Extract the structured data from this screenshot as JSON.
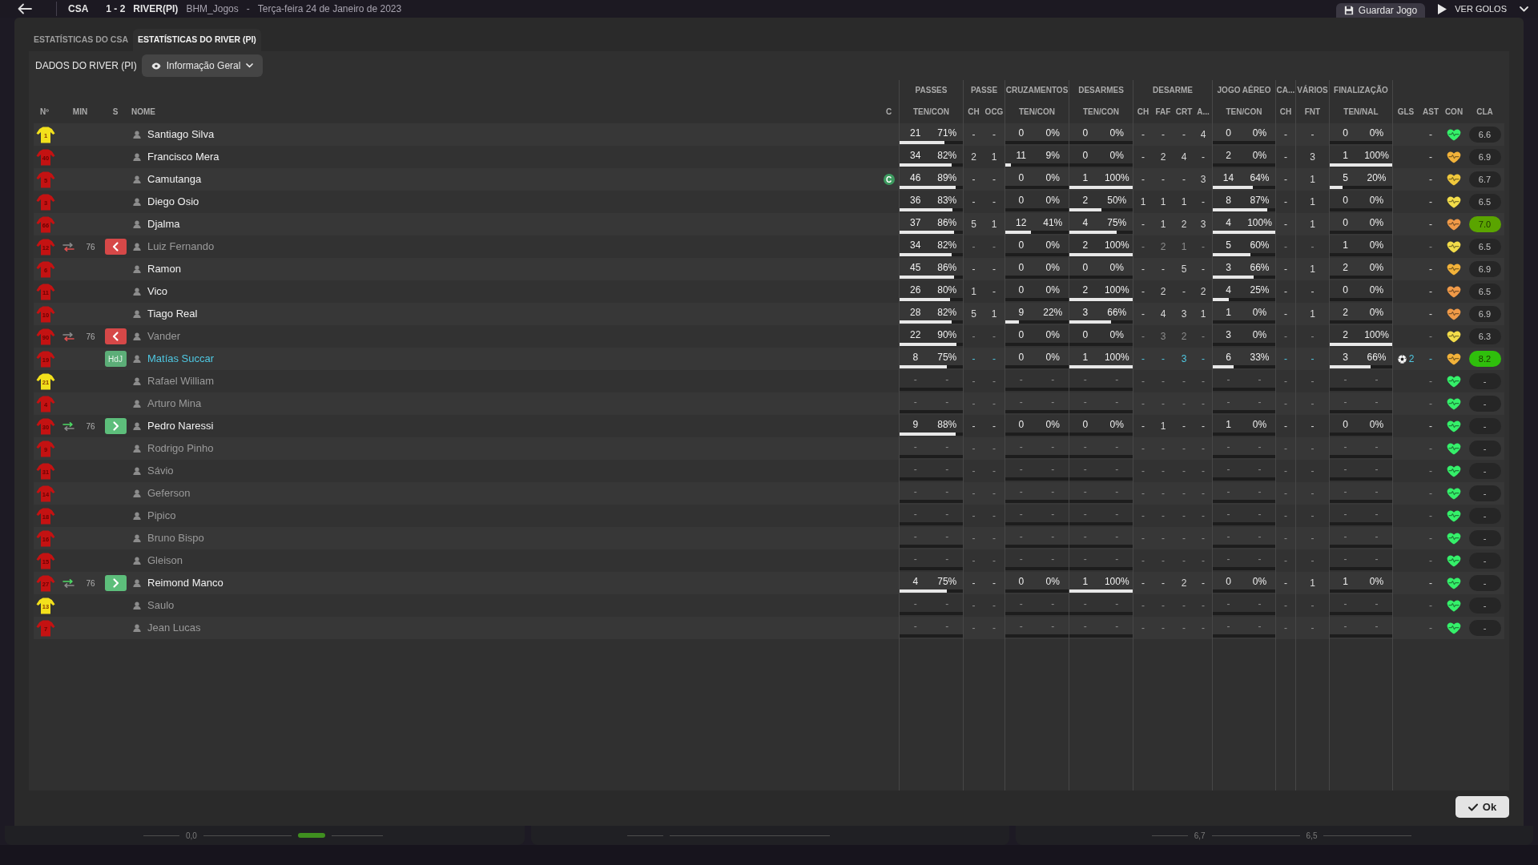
{
  "top_bar": {
    "home_team": "CSA",
    "score": "1 - 2",
    "away_team": "RIVER(PI)",
    "save_name": "BHM_Jogos",
    "separator": "-",
    "date": "Terça-feira 24 de Janeiro de 2023",
    "buttons": [
      {
        "kind": "save",
        "label": "Guardar Jogo"
      },
      {
        "kind": "goals",
        "label": "VER GOLOS"
      }
    ]
  },
  "tabs": [
    {
      "label": "ESTATÍSTICAS DO CSA",
      "selected": false
    },
    {
      "label": "ESTATÍSTICAS DO RIVER (PI)",
      "selected": true
    }
  ],
  "section_title": "DADOS DO RIVER (PI)",
  "view_selector": {
    "label": "Informação Geral"
  },
  "table": {
    "lead_columns": [
      "Nº",
      "MIN",
      "S",
      "NOME",
      "C"
    ],
    "groups": [
      {
        "title": "PASSES",
        "columns": [
          {
            "label": "TEN/CON",
            "kind": "pair"
          }
        ]
      },
      {
        "title": "PASSE",
        "columns": [
          {
            "label": "CH",
            "kind": "single"
          },
          {
            "label": "OCG",
            "kind": "single"
          }
        ]
      },
      {
        "title": "CRUZAMENTOS",
        "columns": [
          {
            "label": "TEN/CON",
            "kind": "pair"
          }
        ]
      },
      {
        "title": "DESARMES",
        "columns": [
          {
            "label": "TEN/CON",
            "kind": "pair"
          }
        ]
      },
      {
        "title": "DESARME",
        "columns": [
          {
            "label": "CH",
            "kind": "single"
          },
          {
            "label": "FAF",
            "kind": "single"
          },
          {
            "label": "CRT",
            "kind": "single"
          },
          {
            "label": "A...",
            "kind": "single"
          }
        ]
      },
      {
        "title": "JOGO AÉREO",
        "columns": [
          {
            "label": "TEN/CON",
            "kind": "pair"
          }
        ]
      },
      {
        "title": "CA...",
        "columns": [
          {
            "label": "CH",
            "kind": "single"
          }
        ]
      },
      {
        "title": "VÁRIOS",
        "columns": [
          {
            "label": "FNT",
            "kind": "single"
          }
        ]
      },
      {
        "title": "FINALIZAÇÃO",
        "columns": [
          {
            "label": "TEN/NAL",
            "kind": "pair"
          }
        ]
      }
    ],
    "tail_columns": [
      "GLS",
      "AST",
      "CON",
      "CLA"
    ],
    "rows": [
      {
        "shirt": {
          "number": "1",
          "color": "#f2e01c"
        },
        "name": "Santiago Silva",
        "kind": "played",
        "stats": [
          {
            "count": "21",
            "rate": "71%",
            "level": 0.71
          },
          "-",
          "-",
          {
            "count": "0",
            "rate": "0%",
            "level": 0
          },
          {
            "count": "0",
            "rate": "0%",
            "level": 0
          },
          "-",
          "-",
          "-",
          "4",
          {
            "count": "0",
            "rate": "0%",
            "level": 0
          },
          "-",
          "-",
          {
            "count": "0",
            "rate": "0%",
            "level": 0
          }
        ],
        "assists": "-",
        "morale": {
          "color": "#35f06a"
        },
        "rating": {
          "value": "6.6",
          "color": "#262626"
        }
      },
      {
        "shirt": {
          "number": "40",
          "color": "#c41212"
        },
        "name": "Francisco Mera",
        "kind": "played",
        "stats": [
          {
            "count": "34",
            "rate": "82%",
            "level": 0.82
          },
          "2",
          "1",
          {
            "count": "11",
            "rate": "9%",
            "level": 0.09
          },
          {
            "count": "0",
            "rate": "0%",
            "level": 0
          },
          "-",
          "2",
          "4",
          "-",
          {
            "count": "2",
            "rate": "0%",
            "level": 0
          },
          "-",
          "3",
          {
            "count": "1",
            "rate": "100%",
            "level": 1
          }
        ],
        "assists": "-",
        "morale": {
          "color": "#f2b23a"
        },
        "rating": {
          "value": "6.9",
          "color": "#262626"
        }
      },
      {
        "shirt": {
          "number": "5",
          "color": "#c41212"
        },
        "name": "Camutanga",
        "kind": "played",
        "captain": "C",
        "stats": [
          {
            "count": "46",
            "rate": "89%",
            "level": 0.89
          },
          "-",
          "-",
          {
            "count": "0",
            "rate": "0%",
            "level": 0
          },
          {
            "count": "1",
            "rate": "100%",
            "level": 1
          },
          "-",
          "-",
          "-",
          "3",
          {
            "count": "14",
            "rate": "64%",
            "level": 0.64
          },
          "-",
          "1",
          {
            "count": "5",
            "rate": "20%",
            "level": 0.2
          }
        ],
        "assists": "-",
        "morale": {
          "color": "#f0c83c"
        },
        "rating": {
          "value": "6.7",
          "color": "#262626"
        }
      },
      {
        "shirt": {
          "number": "3",
          "color": "#c41212"
        },
        "name": "Diego Osio",
        "kind": "played",
        "stats": [
          {
            "count": "36",
            "rate": "83%",
            "level": 0.83
          },
          "-",
          "-",
          {
            "count": "0",
            "rate": "0%",
            "level": 0
          },
          {
            "count": "2",
            "rate": "50%",
            "level": 0.5
          },
          "1",
          "1",
          "1",
          "-",
          {
            "count": "8",
            "rate": "87%",
            "level": 0.87
          },
          "-",
          "1",
          {
            "count": "0",
            "rate": "0%",
            "level": 0
          }
        ],
        "assists": "-",
        "morale": {
          "color": "#f2dc4a"
        },
        "rating": {
          "value": "6.5",
          "color": "#262626"
        }
      },
      {
        "shirt": {
          "number": "66",
          "color": "#c41212"
        },
        "name": "Djalma",
        "kind": "played",
        "stats": [
          {
            "count": "37",
            "rate": "86%",
            "level": 0.86
          },
          "5",
          "1",
          {
            "count": "12",
            "rate": "41%",
            "level": 0.41
          },
          {
            "count": "4",
            "rate": "75%",
            "level": 0.75
          },
          "-",
          "1",
          "2",
          "3",
          {
            "count": "4",
            "rate": "100%",
            "level": 1
          },
          "-",
          "1",
          {
            "count": "0",
            "rate": "0%",
            "level": 0
          }
        ],
        "assists": "-",
        "morale": {
          "color": "#f09a48"
        },
        "rating": {
          "value": "7.0",
          "color": "#5aa400"
        }
      },
      {
        "shirt": {
          "number": "12",
          "color": "#c41212"
        },
        "sub": {
          "kind": "off",
          "minute": "76"
        },
        "badge": {
          "kind": "off"
        },
        "name": "Luiz Fernando",
        "kind": "off",
        "stats": [
          {
            "count": "34",
            "rate": "82%",
            "level": 0.82
          },
          "-",
          "-",
          {
            "count": "0",
            "rate": "0%",
            "level": 0
          },
          {
            "count": "2",
            "rate": "100%",
            "level": 1
          },
          "-",
          "2",
          "1",
          "-",
          {
            "count": "5",
            "rate": "60%",
            "level": 0.6
          },
          "-",
          "-",
          {
            "count": "1",
            "rate": "0%",
            "level": 0
          }
        ],
        "assists": "-",
        "morale": {
          "color": "#f2dc4a"
        },
        "rating": {
          "value": "6.5",
          "color": "#262626"
        }
      },
      {
        "shirt": {
          "number": "6",
          "color": "#c41212"
        },
        "name": "Ramon",
        "kind": "played",
        "stats": [
          {
            "count": "45",
            "rate": "86%",
            "level": 0.86
          },
          "-",
          "-",
          {
            "count": "0",
            "rate": "0%",
            "level": 0
          },
          {
            "count": "0",
            "rate": "0%",
            "level": 0
          },
          "-",
          "-",
          "5",
          "-",
          {
            "count": "3",
            "rate": "66%",
            "level": 0.66
          },
          "-",
          "1",
          {
            "count": "2",
            "rate": "0%",
            "level": 0
          }
        ],
        "assists": "-",
        "morale": {
          "color": "#f2b23a"
        },
        "rating": {
          "value": "6.9",
          "color": "#262626"
        }
      },
      {
        "shirt": {
          "number": "11",
          "color": "#c41212"
        },
        "name": "Vico",
        "kind": "played",
        "stats": [
          {
            "count": "26",
            "rate": "80%",
            "level": 0.8
          },
          "1",
          "-",
          {
            "count": "0",
            "rate": "0%",
            "level": 0
          },
          {
            "count": "2",
            "rate": "100%",
            "level": 1
          },
          "-",
          "2",
          "-",
          "2",
          {
            "count": "4",
            "rate": "25%",
            "level": 0.25
          },
          "-",
          "-",
          {
            "count": "0",
            "rate": "0%",
            "level": 0
          }
        ],
        "assists": "-",
        "morale": {
          "color": "#f09a48"
        },
        "rating": {
          "value": "6.5",
          "color": "#262626"
        }
      },
      {
        "shirt": {
          "number": "10",
          "color": "#c41212"
        },
        "name": "Tiago Real",
        "kind": "played",
        "stats": [
          {
            "count": "28",
            "rate": "82%",
            "level": 0.82
          },
          "5",
          "1",
          {
            "count": "9",
            "rate": "22%",
            "level": 0.22
          },
          {
            "count": "3",
            "rate": "66%",
            "level": 0.66
          },
          "-",
          "4",
          "3",
          "1",
          {
            "count": "1",
            "rate": "0%",
            "level": 0
          },
          "-",
          "1",
          {
            "count": "2",
            "rate": "0%",
            "level": 0
          }
        ],
        "assists": "-",
        "morale": {
          "color": "#f09a48"
        },
        "rating": {
          "value": "6.9",
          "color": "#262626"
        }
      },
      {
        "shirt": {
          "number": "90",
          "color": "#c41212"
        },
        "sub": {
          "kind": "off",
          "minute": "76"
        },
        "badge": {
          "kind": "off"
        },
        "name": "Vander",
        "kind": "off",
        "stats": [
          {
            "count": "22",
            "rate": "90%",
            "level": 0.9
          },
          "-",
          "-",
          {
            "count": "0",
            "rate": "0%",
            "level": 0
          },
          {
            "count": "0",
            "rate": "0%",
            "level": 0
          },
          "-",
          "3",
          "2",
          "-",
          {
            "count": "3",
            "rate": "0%",
            "level": 0
          },
          "-",
          "-",
          {
            "count": "2",
            "rate": "100%",
            "level": 1
          }
        ],
        "assists": "-",
        "morale": {
          "color": "#f2dc4a"
        },
        "rating": {
          "value": "6.3",
          "color": "#262626"
        }
      },
      {
        "shirt": {
          "number": "19",
          "color": "#c41212"
        },
        "badge": {
          "kind": "potm",
          "label": "HdJ"
        },
        "name": "Matías Succar",
        "kind": "star",
        "stats": [
          {
            "count": "8",
            "rate": "75%",
            "level": 0.75
          },
          "-",
          "-",
          {
            "count": "0",
            "rate": "0%",
            "level": 0
          },
          {
            "count": "1",
            "rate": "100%",
            "level": 1
          },
          "-",
          "-",
          "3",
          "-",
          {
            "count": "6",
            "rate": "33%",
            "level": 0.33
          },
          "-",
          "-",
          {
            "count": "3",
            "rate": "66%",
            "level": 0.66
          }
        ],
        "goals": "2",
        "assists": "-",
        "morale": {
          "color": "#f2b23a"
        },
        "rating": {
          "value": "8.2",
          "color": "#2fbf0c"
        }
      },
      {
        "shirt": {
          "number": "21",
          "color": "#f2e01c"
        },
        "name": "Rafael William",
        "kind": "unused",
        "stats": [
          {
            "count": "-",
            "rate": "-",
            "level": 0
          },
          "-",
          "-",
          {
            "count": "-",
            "rate": "-",
            "level": 0
          },
          {
            "count": "-",
            "rate": "-",
            "level": 0
          },
          "-",
          "-",
          "-",
          "-",
          {
            "count": "-",
            "rate": "-",
            "level": 0
          },
          "-",
          "-",
          {
            "count": "-",
            "rate": "-",
            "level": 0
          }
        ],
        "assists": "-",
        "morale": {
          "color": "#35f06a"
        },
        "rating": {
          "value": "-",
          "color": "#262626"
        }
      },
      {
        "shirt": {
          "number": "4",
          "color": "#c41212"
        },
        "name": "Arturo Mina",
        "kind": "unused",
        "stats": [
          {
            "count": "-",
            "rate": "-",
            "level": 0
          },
          "-",
          "-",
          {
            "count": "-",
            "rate": "-",
            "level": 0
          },
          {
            "count": "-",
            "rate": "-",
            "level": 0
          },
          "-",
          "-",
          "-",
          "-",
          {
            "count": "-",
            "rate": "-",
            "level": 0
          },
          "-",
          "-",
          {
            "count": "-",
            "rate": "-",
            "level": 0
          }
        ],
        "assists": "-",
        "morale": {
          "color": "#35f06a"
        },
        "rating": {
          "value": "-",
          "color": "#262626"
        }
      },
      {
        "shirt": {
          "number": "30",
          "color": "#c41212"
        },
        "sub": {
          "kind": "on",
          "minute": "76"
        },
        "badge": {
          "kind": "on"
        },
        "name": "Pedro Naressi",
        "kind": "played",
        "stats": [
          {
            "count": "9",
            "rate": "88%",
            "level": 0.88
          },
          "-",
          "-",
          {
            "count": "0",
            "rate": "0%",
            "level": 0
          },
          {
            "count": "0",
            "rate": "0%",
            "level": 0
          },
          "-",
          "1",
          "-",
          "-",
          {
            "count": "1",
            "rate": "0%",
            "level": 0
          },
          "-",
          "-",
          {
            "count": "0",
            "rate": "0%",
            "level": 0
          }
        ],
        "assists": "-",
        "morale": {
          "color": "#35f06a"
        },
        "rating": {
          "value": "-",
          "color": "#262626"
        }
      },
      {
        "shirt": {
          "number": "9",
          "color": "#c41212"
        },
        "name": "Rodrigo Pinho",
        "kind": "unused",
        "stats": [
          {
            "count": "-",
            "rate": "-",
            "level": 0
          },
          "-",
          "-",
          {
            "count": "-",
            "rate": "-",
            "level": 0
          },
          {
            "count": "-",
            "rate": "-",
            "level": 0
          },
          "-",
          "-",
          "-",
          "-",
          {
            "count": "-",
            "rate": "-",
            "level": 0
          },
          "-",
          "-",
          {
            "count": "-",
            "rate": "-",
            "level": 0
          }
        ],
        "assists": "-",
        "morale": {
          "color": "#35f06a"
        },
        "rating": {
          "value": "-",
          "color": "#262626"
        }
      },
      {
        "shirt": {
          "number": "31",
          "color": "#c41212"
        },
        "name": "Sávio",
        "kind": "unused",
        "stats": [
          {
            "count": "-",
            "rate": "-",
            "level": 0
          },
          "-",
          "-",
          {
            "count": "-",
            "rate": "-",
            "level": 0
          },
          {
            "count": "-",
            "rate": "-",
            "level": 0
          },
          "-",
          "-",
          "-",
          "-",
          {
            "count": "-",
            "rate": "-",
            "level": 0
          },
          "-",
          "-",
          {
            "count": "-",
            "rate": "-",
            "level": 0
          }
        ],
        "assists": "-",
        "morale": {
          "color": "#35f06a"
        },
        "rating": {
          "value": "-",
          "color": "#262626"
        }
      },
      {
        "shirt": {
          "number": "14",
          "color": "#c41212"
        },
        "name": "Geferson",
        "kind": "unused",
        "stats": [
          {
            "count": "-",
            "rate": "-",
            "level": 0
          },
          "-",
          "-",
          {
            "count": "-",
            "rate": "-",
            "level": 0
          },
          {
            "count": "-",
            "rate": "-",
            "level": 0
          },
          "-",
          "-",
          "-",
          "-",
          {
            "count": "-",
            "rate": "-",
            "level": 0
          },
          "-",
          "-",
          {
            "count": "-",
            "rate": "-",
            "level": 0
          }
        ],
        "assists": "-",
        "morale": {
          "color": "#35f06a"
        },
        "rating": {
          "value": "-",
          "color": "#262626"
        }
      },
      {
        "shirt": {
          "number": "18",
          "color": "#c41212"
        },
        "name": "Pipico",
        "kind": "unused",
        "stats": [
          {
            "count": "-",
            "rate": "-",
            "level": 0
          },
          "-",
          "-",
          {
            "count": "-",
            "rate": "-",
            "level": 0
          },
          {
            "count": "-",
            "rate": "-",
            "level": 0
          },
          "-",
          "-",
          "-",
          "-",
          {
            "count": "-",
            "rate": "-",
            "level": 0
          },
          "-",
          "-",
          {
            "count": "-",
            "rate": "-",
            "level": 0
          }
        ],
        "assists": "-",
        "morale": {
          "color": "#35f06a"
        },
        "rating": {
          "value": "-",
          "color": "#262626"
        }
      },
      {
        "shirt": {
          "number": "16",
          "color": "#c41212"
        },
        "name": "Bruno Bispo",
        "kind": "unused",
        "stats": [
          {
            "count": "-",
            "rate": "-",
            "level": 0
          },
          "-",
          "-",
          {
            "count": "-",
            "rate": "-",
            "level": 0
          },
          {
            "count": "-",
            "rate": "-",
            "level": 0
          },
          "-",
          "-",
          "-",
          "-",
          {
            "count": "-",
            "rate": "-",
            "level": 0
          },
          "-",
          "-",
          {
            "count": "-",
            "rate": "-",
            "level": 0
          }
        ],
        "assists": "-",
        "morale": {
          "color": "#35f06a"
        },
        "rating": {
          "value": "-",
          "color": "#262626"
        }
      },
      {
        "shirt": {
          "number": "15",
          "color": "#c41212"
        },
        "name": "Gleison",
        "kind": "unused",
        "stats": [
          {
            "count": "-",
            "rate": "-",
            "level": 0
          },
          "-",
          "-",
          {
            "count": "-",
            "rate": "-",
            "level": 0
          },
          {
            "count": "-",
            "rate": "-",
            "level": 0
          },
          "-",
          "-",
          "-",
          "-",
          {
            "count": "-",
            "rate": "-",
            "level": 0
          },
          "-",
          "-",
          {
            "count": "-",
            "rate": "-",
            "level": 0
          }
        ],
        "assists": "-",
        "morale": {
          "color": "#35f06a"
        },
        "rating": {
          "value": "-",
          "color": "#262626"
        }
      },
      {
        "shirt": {
          "number": "27",
          "color": "#c41212"
        },
        "sub": {
          "kind": "on",
          "minute": "76"
        },
        "badge": {
          "kind": "on"
        },
        "name": "Reimond Manco",
        "kind": "played",
        "stats": [
          {
            "count": "4",
            "rate": "75%",
            "level": 0.75
          },
          "-",
          "-",
          {
            "count": "0",
            "rate": "0%",
            "level": 0
          },
          {
            "count": "1",
            "rate": "100%",
            "level": 1
          },
          "-",
          "-",
          "2",
          "-",
          {
            "count": "0",
            "rate": "0%",
            "level": 0
          },
          "-",
          "1",
          {
            "count": "1",
            "rate": "0%",
            "level": 0
          }
        ],
        "assists": "-",
        "morale": {
          "color": "#35f06a"
        },
        "rating": {
          "value": "-",
          "color": "#262626"
        }
      },
      {
        "shirt": {
          "number": "13",
          "color": "#f2e01c"
        },
        "name": "Saulo",
        "kind": "unused",
        "stats": [
          {
            "count": "-",
            "rate": "-",
            "level": 0
          },
          "-",
          "-",
          {
            "count": "-",
            "rate": "-",
            "level": 0
          },
          {
            "count": "-",
            "rate": "-",
            "level": 0
          },
          "-",
          "-",
          "-",
          "-",
          {
            "count": "-",
            "rate": "-",
            "level": 0
          },
          "-",
          "-",
          {
            "count": "-",
            "rate": "-",
            "level": 0
          }
        ],
        "assists": "-",
        "morale": {
          "color": "#35f06a"
        },
        "rating": {
          "value": "-",
          "color": "#262626"
        }
      },
      {
        "shirt": {
          "number": "7",
          "color": "#c41212"
        },
        "name": "Jean Lucas",
        "kind": "unused",
        "stats": [
          {
            "count": "-",
            "rate": "-",
            "level": 0
          },
          "-",
          "-",
          {
            "count": "-",
            "rate": "-",
            "level": 0
          },
          {
            "count": "-",
            "rate": "-",
            "level": 0
          },
          "-",
          "-",
          "-",
          "-",
          {
            "count": "-",
            "rate": "-",
            "level": 0
          },
          "-",
          "-",
          {
            "count": "-",
            "rate": "-",
            "level": 0
          }
        ],
        "assists": "-",
        "morale": {
          "color": "#35f06a"
        },
        "rating": {
          "value": "-",
          "color": "#262626"
        }
      }
    ]
  },
  "ok_button": {
    "label": "Ok"
  },
  "background_panels": [
    {
      "labels": [
        "0,0"
      ],
      "marker": true
    },
    {
      "marker": false
    },
    {
      "labels": [
        "6,7",
        "6,5"
      ],
      "marker": false
    }
  ]
}
